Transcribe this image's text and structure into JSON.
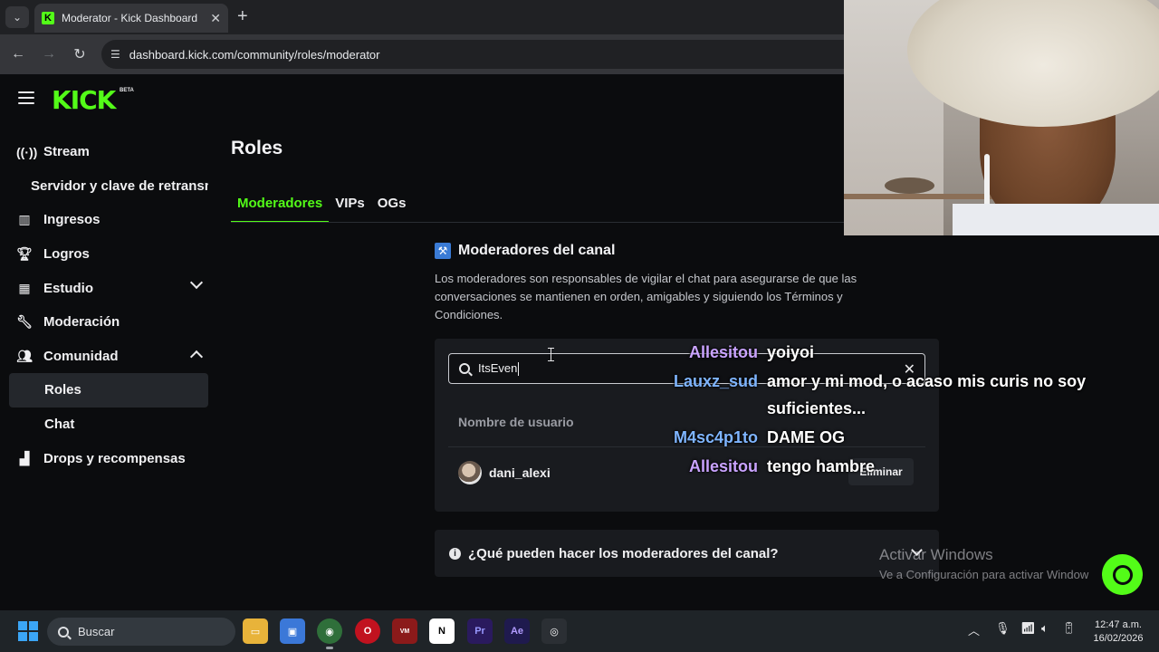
{
  "browser": {
    "tab_title": "Moderator - Kick Dashboard",
    "url": "dashboard.kick.com/community/roles/moderator"
  },
  "brand": {
    "logo": "KICK",
    "beta": "BETA",
    "accent": "#53fc18"
  },
  "sidebar": {
    "items": [
      {
        "label": "Stream",
        "icon": "broadcast-icon"
      },
      {
        "label": "Servidor y clave de retransm"
      },
      {
        "label": "Ingresos",
        "icon": "chart-icon"
      },
      {
        "label": "Logros",
        "icon": "trophy-icon"
      },
      {
        "label": "Estudio",
        "icon": "studio-icon"
      },
      {
        "label": "Moderación",
        "icon": "wrench-icon"
      },
      {
        "label": "Comunidad",
        "icon": "people-icon"
      },
      {
        "label": "Roles"
      },
      {
        "label": "Chat"
      },
      {
        "label": "Drops y recompensas",
        "icon": "drops-icon"
      }
    ]
  },
  "main": {
    "title": "Roles",
    "tabs": [
      "Moderadores",
      "VIPs",
      "OGs"
    ],
    "section_title": "Moderadores del canal",
    "section_desc": "Los moderadores son responsables de vigilar el chat para asegurarse de que las conversaciones se mantienen en orden, amigables y siguiendo los Términos y Condiciones.",
    "search_value": "ItsEven",
    "column_header": "Nombre de usuario",
    "rows": [
      {
        "username": "dani_alexi",
        "action": "Eliminar"
      }
    ],
    "faq": "¿Qué pueden hacer los moderadores del canal?"
  },
  "chat_overlay": [
    {
      "user": "Allesitou",
      "msg": "yoiyoi",
      "color": "#c9a3ff"
    },
    {
      "user": "Lauxz_sud",
      "msg": "amor y mi mod, o acaso mis curis no soy",
      "msg2": "suficientes...",
      "color": "#7fb5ff"
    },
    {
      "user": "M4sc4p1to",
      "msg": "DAME OG",
      "color": "#7fb5ff"
    },
    {
      "user": "Allesitou",
      "msg": "tengo hambre",
      "color": "#c9a3ff"
    }
  ],
  "watermark": {
    "title": "Activar Windows",
    "subtitle": "Ve a Configuración para activar Window"
  },
  "taskbar": {
    "search_placeholder": "Buscar",
    "time": "12:47 a.m.",
    "date": "16/02/2026"
  }
}
